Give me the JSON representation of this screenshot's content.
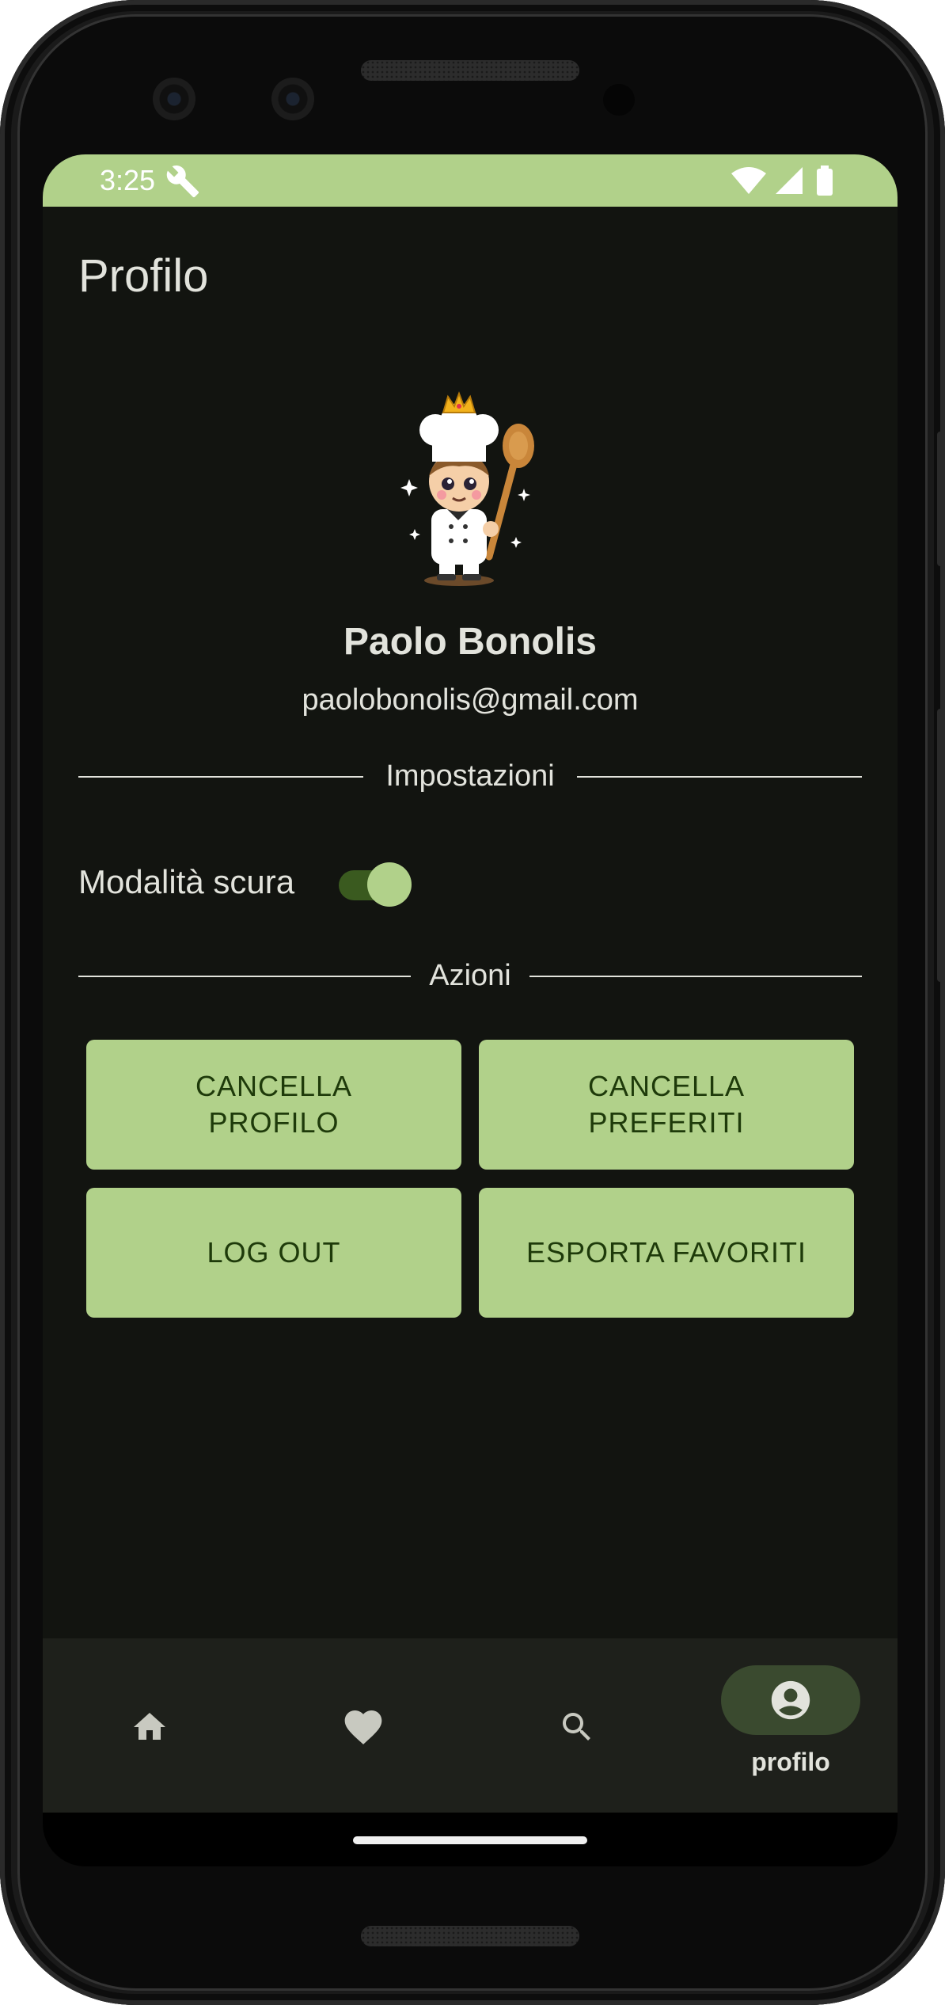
{
  "status_bar": {
    "time": "3:25",
    "icons": [
      "wrench-icon",
      "wifi-icon",
      "signal-icon",
      "battery-icon"
    ],
    "color": "#b1d18a"
  },
  "page": {
    "title": "Profilo"
  },
  "profile": {
    "avatar": "chef-avatar",
    "name": "Paolo Bonolis",
    "email": "paolobonolis@gmail.com"
  },
  "settings": {
    "section_label": "Impostazioni",
    "dark_mode_label": "Modalità scura",
    "dark_mode_on": true
  },
  "actions": {
    "section_label": "Azioni",
    "buttons": [
      {
        "label": "CANCELLA PROFILO"
      },
      {
        "label": "CANCELLA PREFERITI"
      },
      {
        "label": "LOG OUT"
      },
      {
        "label": "ESPORTA FAVORITI"
      }
    ]
  },
  "bottom_nav": {
    "items": [
      {
        "icon": "home-icon",
        "label": "",
        "active": false
      },
      {
        "icon": "heart-icon",
        "label": "",
        "active": false
      },
      {
        "icon": "search-icon",
        "label": "",
        "active": false
      },
      {
        "icon": "account-icon",
        "label": "profilo",
        "active": true
      }
    ]
  },
  "colors": {
    "background": "#121410",
    "accent": "#b1d18a",
    "button_text": "#1e3a0a",
    "text": "#e2e3dc",
    "nav_background": "#1e201b",
    "nav_active_pill": "#3a4a2f"
  }
}
